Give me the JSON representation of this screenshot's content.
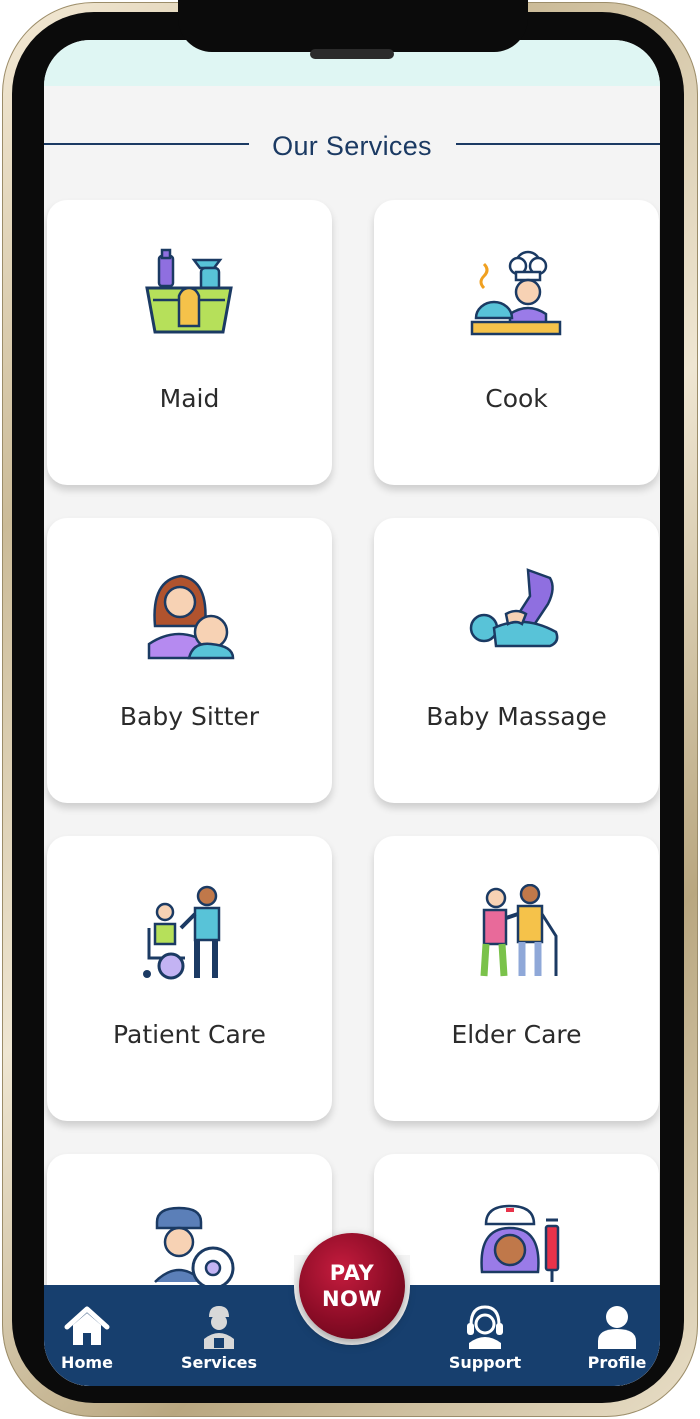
{
  "header": {
    "title": "Our Services"
  },
  "services": [
    {
      "label": "Maid",
      "icon": "cleaning-basket-icon"
    },
    {
      "label": "Cook",
      "icon": "chef-icon"
    },
    {
      "label": "Baby Sitter",
      "icon": "mother-baby-icon"
    },
    {
      "label": "Baby Massage",
      "icon": "baby-massage-icon"
    },
    {
      "label": "Patient Care",
      "icon": "wheelchair-caregiver-icon"
    },
    {
      "label": "Elder Care",
      "icon": "elderly-walking-icon"
    },
    {
      "label": "",
      "icon": "driver-icon"
    },
    {
      "label": "",
      "icon": "nurse-icon"
    }
  ],
  "pay_button": {
    "line1": "PAY",
    "line2": "NOW"
  },
  "bottom_nav": {
    "items": [
      {
        "label": "Home",
        "icon": "home-icon"
      },
      {
        "label": "Services",
        "icon": "worker-icon"
      },
      {
        "label": "Support",
        "icon": "support-agent-icon"
      },
      {
        "label": "Profile",
        "icon": "user-icon"
      }
    ]
  },
  "colors": {
    "primary": "#173f6e",
    "accent": "#8b0c26",
    "background": "#f4f4f4",
    "card": "#ffffff"
  }
}
